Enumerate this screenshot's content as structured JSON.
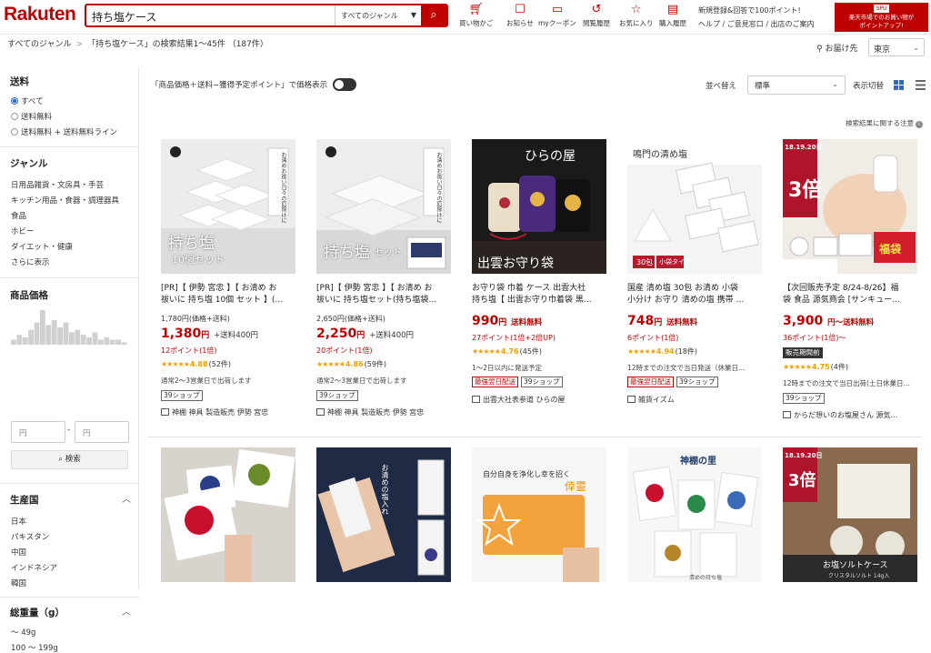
{
  "header": {
    "logo": "Rakuten",
    "search_value": "持ち塩ケース",
    "genre_label": "すべてのジャンル",
    "icons": [
      {
        "label": "買い物かご",
        "icon": "cart-icon"
      },
      {
        "label": "お知らせ",
        "icon": "notification-icon"
      },
      {
        "label": "myクーポン",
        "icon": "coupon-icon"
      },
      {
        "label": "閲覧履歴",
        "icon": "history-icon"
      },
      {
        "label": "お気に入り",
        "icon": "star-icon"
      },
      {
        "label": "購入履歴",
        "icon": "receipt-icon"
      }
    ],
    "right_line1": "新規登録&回答で100ポイント!",
    "right_line2": "ヘルプ / ご意見窓口 / 出店のご案内",
    "promo_top": "SPU",
    "promo_line1": "楽天市場でのお買い物が",
    "promo_line2": "ポイントアップ!"
  },
  "breadcrumb": {
    "root": "すべてのジャンル",
    "result": "「持ち塩ケース」の検索結果1〜45件 （187件）"
  },
  "delivery": {
    "label": "お届け先",
    "pref": "東京"
  },
  "sidebar": {
    "shipping_title": "送料",
    "shipping_options": [
      "すべて",
      "送料無料",
      "送料無料 + 送料無料ライン"
    ],
    "genre_title": "ジャンル",
    "genres": [
      "日用品雑貨・文房具・手芸",
      "キッチン用品・食器・調理器具",
      "食品",
      "ホビー",
      "ダイエット・健康",
      "さらに表示"
    ],
    "price_title": "商品価格",
    "price_histogram": [
      2,
      4,
      3,
      6,
      9,
      14,
      8,
      10,
      7,
      9,
      5,
      6,
      4,
      3,
      5,
      2,
      3,
      2,
      2,
      1
    ],
    "price_min_placeholder": "円",
    "price_max_placeholder": "円",
    "price_search": "検索",
    "origin_title": "生産国",
    "origins": [
      "日本",
      "パキスタン",
      "中国",
      "インドネシア",
      "韓国"
    ],
    "weight_title": "総重量（g）",
    "weights": [
      "〜 49g",
      "100 〜 199g"
    ]
  },
  "toolbar": {
    "price_toggle_label": "「商品価格＋送料−獲得予定ポイント」で価格表示",
    "sort_label": "並べ替え",
    "sort_value": "標準",
    "view_label": "表示切替",
    "notice": "検索結果に関する注意"
  },
  "products": [
    {
      "title": "[PR]【 伊勢 宮忠 】【 お清め お",
      "title2": "祓いに 持ち塩 10個 セット 】(…",
      "ref_price": "1,780円(価格+送料)",
      "price": "1,380",
      "shipping": "+送料400円",
      "points": "12ポイント(1倍)",
      "rating": "4.88",
      "reviews": "(52件)",
      "ship_note": "通常2〜3営業日で出荷します",
      "tags": [
        "39ショップ"
      ],
      "shop": "神棚 神具 製造販売 伊勢 宮忠",
      "img_text1": "持ち塩",
      "img_text2": "10個セット",
      "img_vert": "お清めお祓い日々の厄除けに"
    },
    {
      "title": "[PR]【 伊勢 宮忠 】【 お清め お",
      "title2": "祓いに 持ち塩セット(持ち塩袋…",
      "ref_price": "2,650円(価格+送料)",
      "price": "2,250",
      "shipping": "+送料400円",
      "points": "20ポイント(1倍)",
      "rating": "4.86",
      "reviews": "(59件)",
      "ship_note": "通常2〜3営業日で出荷します",
      "tags": [
        "39ショップ"
      ],
      "shop": "神棚 神具 製造販売 伊勢 宮忠",
      "img_text1": "持ち塩",
      "img_text2": "セット",
      "img_vert": "お清めお祓い日々の厄除けに"
    },
    {
      "title": "お守り袋 巾着 ケース 出雲大社",
      "title2": "持ち塩【 出雲お守り巾着袋 黒…",
      "price": "990",
      "shipping": "送料無料",
      "points": "27ポイント(1倍+2倍UP)",
      "rating": "4.76",
      "reviews": "(45件)",
      "ship_note": "1〜2日以内に発送予定",
      "tags": [
        "最強翌日配送",
        "39ショップ"
      ],
      "shop": "出雲大社表参道 ひらの屋",
      "img_text1": "ひらの屋",
      "img_text2": "出雲お守り袋"
    },
    {
      "title": "国産 清め塩 30包 お清め 小袋",
      "title2": "小分け お守り 清めの塩 携帯 …",
      "price": "748",
      "shipping": "送料無料",
      "points": "6ポイント(1倍)",
      "rating": "4.94",
      "reviews": "(18件)",
      "ship_note": "12時までの注文で当日発送（休業日…",
      "tags": [
        "最強翌日配送",
        "39ショップ"
      ],
      "shop": "雑貨イズム",
      "img_text1": "鳴門の清め塩",
      "img_text2": "30包",
      "img_text3": "小袋タイプ"
    },
    {
      "title": "【次回販売予定 8/24-8/26】福",
      "title2": "袋 食品 源気商会 [サンキュー…",
      "price": "3,900",
      "shipping": "円〜送料無料",
      "points": "36ポイント(1倍)〜",
      "rating": "4.75",
      "reviews": "(4件)",
      "badge": "販売期間前",
      "ship_note": "12時までの注文で当日出荷(土日休業日…",
      "tags": [
        "39ショップ"
      ],
      "shop": "からだ想いのお塩屋さん 源気…",
      "img_text1": "18.19.20日",
      "img_text2": "3倍",
      "img_text3": "福袋"
    }
  ],
  "row2": [
    {
      "img_text": ""
    },
    {
      "img_text": "お清めの塩入れ"
    },
    {
      "img_text": "自分自身を浄化し幸を招く",
      "img_text2": "倖靈"
    },
    {
      "img_text": "神棚の里",
      "img_text2": "清めの持ち塩"
    },
    {
      "img_text": "18.19.20日",
      "img_text2": "3倍",
      "img_text3": "お塩ソルトケース",
      "img_text4": "クリスタルソルト 14g入"
    }
  ],
  "colors": {
    "brand": "#bf0000",
    "link_blue": "#2a6ac8",
    "star": "#f5a000"
  }
}
